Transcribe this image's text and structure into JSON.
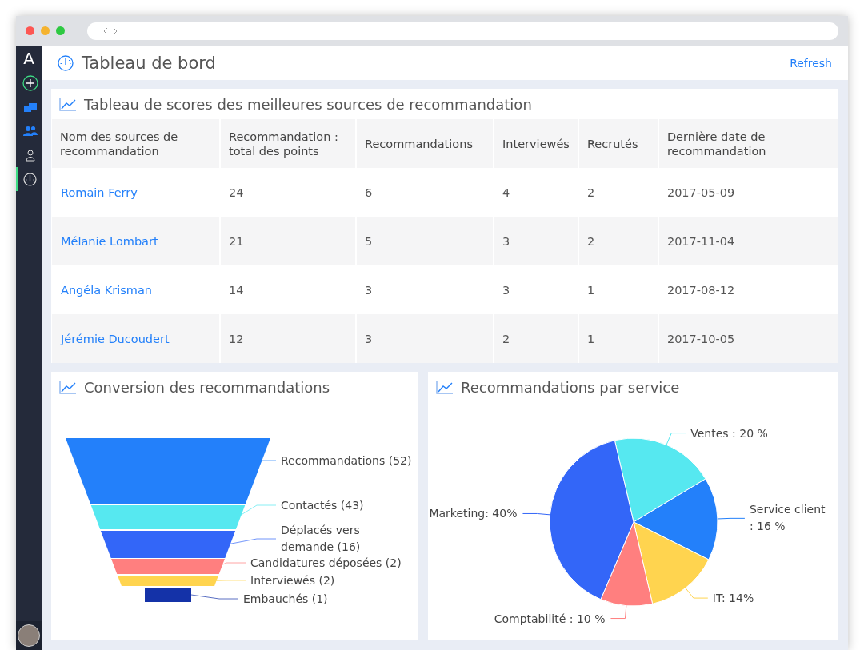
{
  "sidebar": {
    "logo": "A",
    "items": [
      {
        "kind": "add",
        "selected": false
      },
      {
        "kind": "folders",
        "selected": false
      },
      {
        "kind": "people",
        "selected": false
      },
      {
        "kind": "person",
        "selected": false
      },
      {
        "kind": "gauge",
        "selected": true
      }
    ]
  },
  "header": {
    "title": "Tableau de bord",
    "refresh": "Refresh"
  },
  "scoreboard": {
    "title": "Tableau de scores des meilleures sources de recommandation",
    "columns": [
      "Nom des sources de recommandation",
      "Recommandation : total des points",
      "Recommandations",
      "Interviewés",
      "Recrutés",
      "Dernière date de recommandation"
    ],
    "rows": [
      {
        "cells": [
          "Romain Ferry",
          "24",
          "6",
          "4",
          "2",
          "2017-05-09"
        ]
      },
      {
        "cells": [
          "Mélanie Lombart",
          "21",
          "5",
          "3",
          "2",
          "2017-11-04"
        ]
      },
      {
        "cells": [
          "Angéla Krisman",
          "14",
          "3",
          "3",
          "1",
          "2017-08-12"
        ]
      },
      {
        "cells": [
          "Jérémie Ducoudert",
          "12",
          "3",
          "2",
          "1",
          "2017-10-05"
        ]
      }
    ]
  },
  "conversion": {
    "title": "Conversion des recommandations",
    "stages": [
      {
        "label": "Recommandations (52)",
        "color": "#2380fa"
      },
      {
        "label": "Contactés (43)",
        "color": "#56e8f0"
      },
      {
        "label": "Déplacés vers demande (16)",
        "color": "#3366f8"
      },
      {
        "label": "Candidatures déposées (2)",
        "color": "#ff7f7f"
      },
      {
        "label": "Interviewés (2)",
        "color": "#ffd44f"
      },
      {
        "label": "Embauchés (1)",
        "color": "#1432a8"
      }
    ]
  },
  "by_service": {
    "title": "Recommandations par service",
    "chart_data": {
      "type": "pie",
      "categories": [
        "Ventes : 20 %",
        "Service client : 16 %",
        "IT: 14%",
        "Comptabilité : 10 %",
        "Marketing: 40%"
      ],
      "values": [
        20,
        16,
        14,
        10,
        40
      ],
      "colors": [
        "#56e8f0",
        "#2380fa",
        "#ffd44f",
        "#ff7f7f",
        "#3366f8"
      ]
    }
  }
}
